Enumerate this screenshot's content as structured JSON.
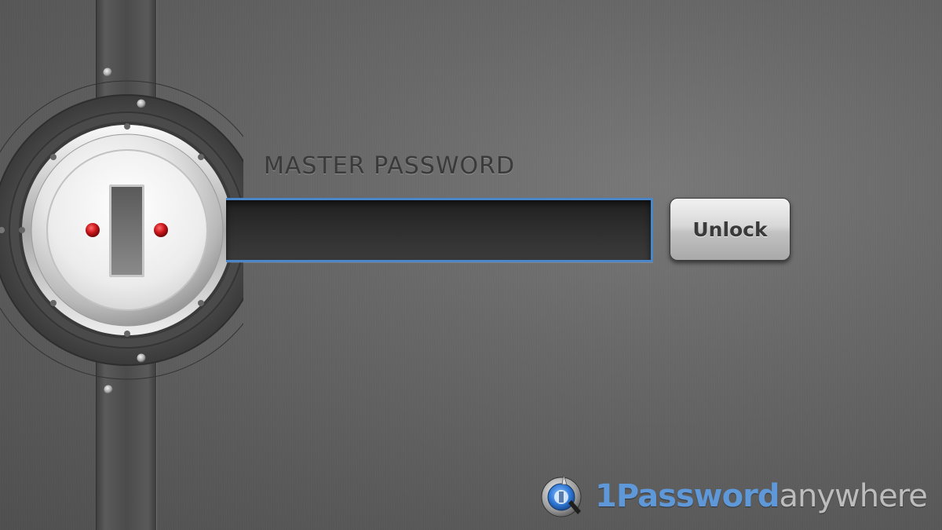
{
  "app": {
    "name": "1Password anywhere"
  },
  "unlock_form": {
    "label": "MASTER PASSWORD",
    "password_value": "",
    "unlock_label": "Unlock"
  },
  "branding": {
    "name_primary": "1Password",
    "name_secondary": "anywhere",
    "logo_icon": "1password-keyhole-logo-icon"
  },
  "vault_door": {
    "lock_icon": "keyhole-dial-icon",
    "indicator_color": "#c8141a"
  },
  "colors": {
    "field_focus": "#4a86c8",
    "brand_blue": "#5f98d8",
    "background": "#646464"
  }
}
